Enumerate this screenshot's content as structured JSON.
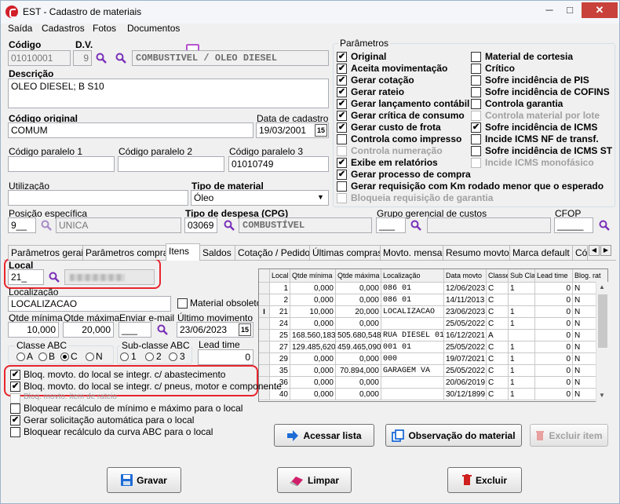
{
  "window": {
    "title": "EST - Cadastro de materiais",
    "minimize": "─",
    "maximize": "□",
    "close": "✕"
  },
  "menu": [
    {
      "label": "Saída"
    },
    {
      "label": "Cadastros"
    },
    {
      "label": "Fotos"
    },
    {
      "label": "Documentos"
    }
  ],
  "codigo": {
    "label": "Código",
    "value": "01010001"
  },
  "dv": {
    "label": "D.V.",
    "value": "9"
  },
  "material_name": "COMBUSTIVEL / OLEO DIESEL",
  "descricao": {
    "label": "Descrição",
    "value": "OLEO DIESEL; B S10"
  },
  "codigo_original": {
    "label": "Código original",
    "value": "COMUM"
  },
  "data_cadastro": {
    "label": "Data de cadastro",
    "value": "19/03/2001",
    "cal": "15"
  },
  "paralelos": [
    {
      "label": "Código paralelo 1",
      "value": ""
    },
    {
      "label": "Código paralelo 2",
      "value": ""
    },
    {
      "label": "Código paralelo 3",
      "value": "01010749"
    }
  ],
  "utilizacao": {
    "label": "Utilização",
    "value": ""
  },
  "tipo_material": {
    "label": "Tipo de material",
    "value": "Óleo"
  },
  "posicao": {
    "label": "Posição específica",
    "code": "9__",
    "name": "UNICA"
  },
  "tipo_despesa": {
    "label": "Tipo de despesa (CPG)",
    "code": "03069",
    "name": "COMBUSTÍVEL"
  },
  "grupo": {
    "label": "Grupo gerencial de custos",
    "code": "___",
    "name": ""
  },
  "cfop": {
    "label": "CFOP",
    "value": "_____"
  },
  "parametros": {
    "title": "Parâmetros",
    "left": [
      {
        "label": "Original",
        "checked": true,
        "enabled": true
      },
      {
        "label": "Aceita movimentação",
        "checked": true,
        "enabled": true
      },
      {
        "label": "Gerar cotação",
        "checked": true,
        "enabled": true
      },
      {
        "label": "Gerar rateio",
        "checked": true,
        "enabled": true
      },
      {
        "label": "Gerar lançamento contábil",
        "checked": true,
        "enabled": true
      },
      {
        "label": "Gerar crítica de consumo",
        "checked": true,
        "enabled": true
      },
      {
        "label": "Gerar custo de frota",
        "checked": true,
        "enabled": true
      },
      {
        "label": "Controla como impresso",
        "checked": false,
        "enabled": true
      },
      {
        "label": "Controla numeração",
        "checked": false,
        "enabled": false
      },
      {
        "label": "Exibe em relatórios",
        "checked": true,
        "enabled": true
      },
      {
        "label": "Gerar processo de compra",
        "checked": true,
        "enabled": true
      },
      {
        "label": "Gerar requisição com Km rodado menor que o esperado",
        "checked": false,
        "enabled": true
      },
      {
        "label": "Bloqueia requisição de garantia",
        "checked": false,
        "enabled": false
      }
    ],
    "right": [
      {
        "label": "Material de cortesia",
        "checked": false,
        "enabled": true
      },
      {
        "label": "Crítico",
        "checked": false,
        "enabled": true
      },
      {
        "label": "Sofre incidência de PIS",
        "checked": false,
        "enabled": true
      },
      {
        "label": "Sofre incidência de COFINS",
        "checked": false,
        "enabled": true
      },
      {
        "label": "Controla garantia",
        "checked": false,
        "enabled": true
      },
      {
        "label": "Controla material por lote",
        "checked": false,
        "enabled": false
      },
      {
        "label": "Sofre incidência de ICMS",
        "checked": true,
        "enabled": true
      },
      {
        "label": "Incide ICMS NF de transf.",
        "checked": false,
        "enabled": true
      },
      {
        "label": "Sofre incidência de ICMS ST",
        "checked": false,
        "enabled": true
      },
      {
        "label": "Incide ICMS monofásico",
        "checked": false,
        "enabled": false
      }
    ]
  },
  "tabs": [
    {
      "label": "Parâmetros gerais"
    },
    {
      "label": "Parâmetros compras"
    },
    {
      "label": "Itens"
    },
    {
      "label": "Saldos"
    },
    {
      "label": "Cotação / Pedido"
    },
    {
      "label": "Últimas compras"
    },
    {
      "label": "Movto. mensal"
    },
    {
      "label": "Resumo movto."
    },
    {
      "label": "Marca default"
    },
    {
      "label": "Códi"
    }
  ],
  "local": {
    "label": "Local",
    "value": "21_"
  },
  "localizacao": {
    "label": "Localização",
    "value": "LOCALIZACAO"
  },
  "material_obsoleto": {
    "label": "Material obsoleto",
    "checked": false
  },
  "qtde_minima": {
    "label": "Qtde mínima",
    "value": "10,000"
  },
  "qtde_maxima": {
    "label": "Qtde máxima",
    "value": "20,000"
  },
  "enviar_email": {
    "label": "Enviar e-mail",
    "value": "___"
  },
  "ultimo_movimento": {
    "label": "Último movimento",
    "value": "23/06/2023",
    "cal": "15"
  },
  "classe_abc": {
    "label": "Classe ABC",
    "options": [
      "A",
      "B",
      "C",
      "N"
    ],
    "selected": "C"
  },
  "sub_classe_abc": {
    "label": "Sub-classe ABC",
    "options": [
      "1",
      "2",
      "3"
    ],
    "selected": ""
  },
  "lead_time": {
    "label": "Lead time",
    "value": "0"
  },
  "local_checks": [
    {
      "label": "Bloq. movto. do local se integr. c/ abastecimento",
      "checked": true,
      "enabled": true
    },
    {
      "label": "Bloq. movto. do local se integr. c/ pneus, motor e componente",
      "checked": true,
      "enabled": true
    },
    {
      "label": "Bloq. movto. item de rateio",
      "checked": false,
      "enabled": false
    },
    {
      "label": "Bloquear recálculo de mínimo e máximo para o local",
      "checked": false,
      "enabled": true
    },
    {
      "label": "Gerar solicitação automática para o local",
      "checked": true,
      "enabled": true
    },
    {
      "label": "Bloquear recálculo da curva ABC para o local",
      "checked": false,
      "enabled": true
    }
  ],
  "grid": {
    "headers": [
      "Local",
      "Qtde mínima",
      "Qtde máxima",
      "Localização",
      "Data movto",
      "Classe",
      "Sub Cla",
      "Lead time",
      "Blog. rat"
    ],
    "rows": [
      [
        "1",
        "0,000",
        "0,000",
        "086 01",
        "12/06/2023",
        "C",
        "1",
        "0",
        "N"
      ],
      [
        "2",
        "0,000",
        "0,000",
        "086 01",
        "14/11/2013",
        "C",
        "",
        "0",
        "N"
      ],
      [
        "21",
        "10,000",
        "20,000",
        "LOCALIZACAO",
        "23/06/2023",
        "C",
        "1",
        "0",
        "N"
      ],
      [
        "24",
        "0,000",
        "0,000",
        "",
        "25/05/2022",
        "C",
        "1",
        "0",
        "N"
      ],
      [
        "25",
        "168.560,183",
        "505.680,548",
        "RUA DIESEL 01",
        "16/12/2021",
        "A",
        "",
        "0",
        "N"
      ],
      [
        "27",
        "129.485,620",
        "459.465,090",
        "001 01",
        "25/05/2022",
        "C",
        "1",
        "0",
        "N"
      ],
      [
        "29",
        "0,000",
        "0,000",
        "000",
        "19/07/2021",
        "C",
        "1",
        "0",
        "N"
      ],
      [
        "35",
        "0,000",
        "70.894,000",
        "GARAGEM VA",
        "25/05/2022",
        "C",
        "1",
        "0",
        "N"
      ],
      [
        "36",
        "0,000",
        "0,000",
        "",
        "20/06/2019",
        "C",
        "1",
        "0",
        "N"
      ],
      [
        "40",
        "0,000",
        "0,000",
        "",
        "30/12/1899",
        "C",
        "1",
        "0",
        "N"
      ]
    ],
    "current_row_marker": "I"
  },
  "buttons": {
    "acessar": "Acessar lista",
    "observacao": "Observação do material",
    "excluir_item": "Excluir item",
    "gravar": "Gravar",
    "limpar": "Limpar",
    "excluir": "Excluir"
  },
  "colors": {
    "highlight": "#e8242d",
    "accent_blue": "#1e6bd6",
    "delete_red": "#d01f1f"
  }
}
